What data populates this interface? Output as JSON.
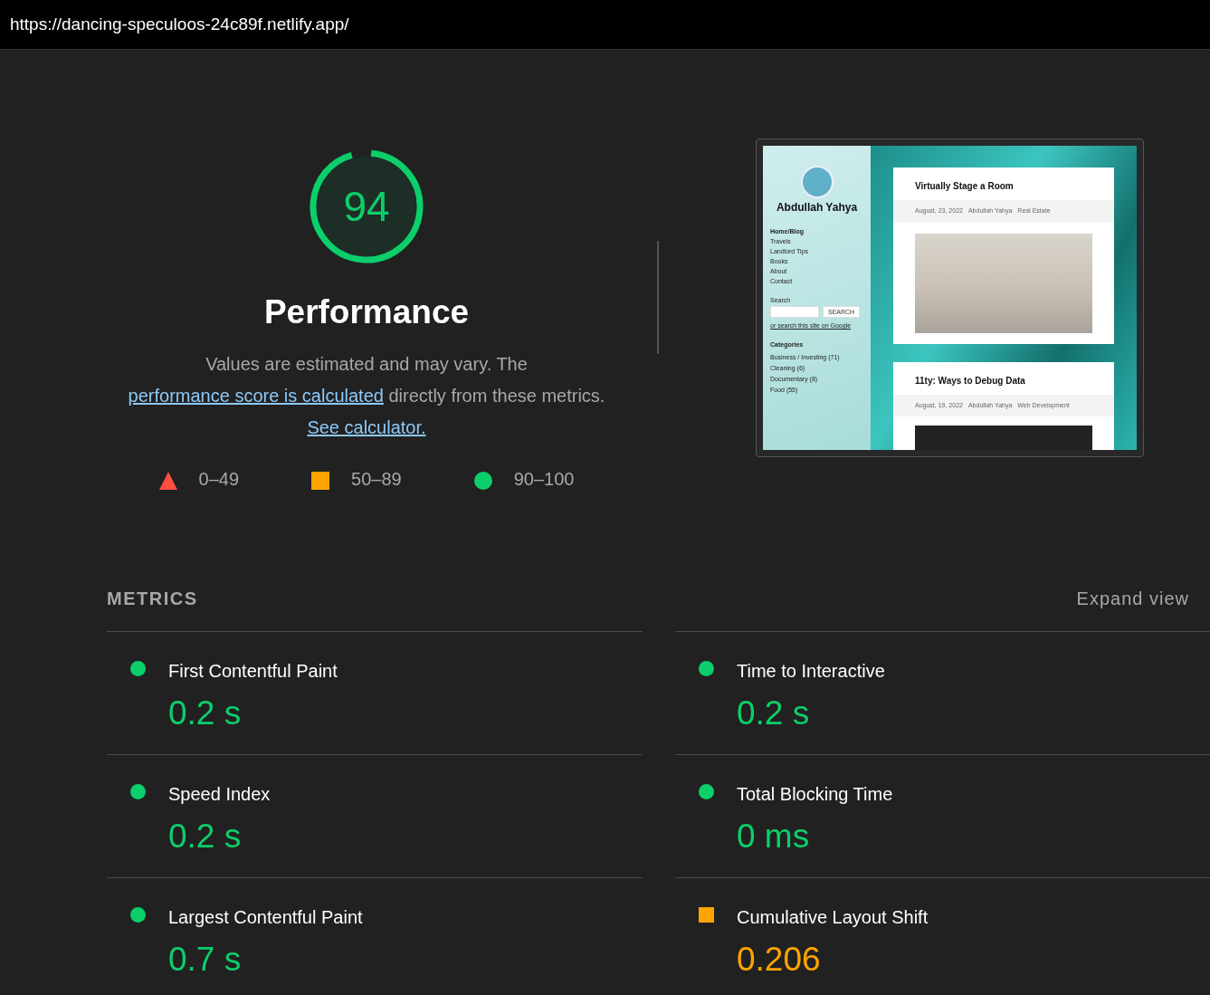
{
  "address_bar": {
    "url": "https://dancing-speculoos-24c89f.netlify.app/"
  },
  "gauge": {
    "score": "94",
    "level": 0.94,
    "kind": "pass",
    "title": "Performance"
  },
  "description": [
    {
      "kind": "text",
      "text": "Values are estimated and may vary. The"
    },
    {
      "kind": "link",
      "text": "performance score is calculated"
    },
    {
      "kind": "text",
      "text": "directly from these metrics."
    },
    {
      "kind": "link",
      "text": "See calculator."
    }
  ],
  "legend": [
    {
      "kind": "fail",
      "label": "0–49"
    },
    {
      "kind": "average",
      "label": "50–89"
    },
    {
      "kind": "pass",
      "label": "90–100"
    }
  ],
  "thumbnail": {
    "site_title": "Abdullah Yahya",
    "nav": [
      {
        "label": "Home/Blog",
        "selected": true
      },
      {
        "label": "Travels",
        "selected": false
      },
      {
        "label": "Landlord Tips",
        "selected": false
      },
      {
        "label": "Books",
        "selected": false
      },
      {
        "label": "About",
        "selected": false
      },
      {
        "label": "Contact",
        "selected": false
      }
    ],
    "search_label": "Search",
    "search_button": "SEARCH",
    "google_link": "or search this site on Google",
    "categories_title": "Categories",
    "categories": [
      "Business / Investing (71)",
      "Cleaning (6)",
      "Documentary (8)",
      "Food (55)"
    ],
    "posts": [
      {
        "title": "Virtually Stage a Room",
        "date": "August, 23, 2022",
        "author": "Abdullah Yahya",
        "category": "Real Estate",
        "kind": "photo"
      },
      {
        "title": "11ty: Ways to Debug Data",
        "date": "August, 19, 2022",
        "author": "Abdullah Yahya",
        "category": "Web Development",
        "kind": "code"
      }
    ]
  },
  "metrics": {
    "title": "METRICS",
    "expand": "Expand view",
    "items": [
      {
        "name": "First Contentful Paint",
        "value": "0.2 s",
        "kind": "pass"
      },
      {
        "name": "Time to Interactive",
        "value": "0.2 s",
        "kind": "pass"
      },
      {
        "name": "Speed Index",
        "value": "0.2 s",
        "kind": "pass"
      },
      {
        "name": "Total Blocking Time",
        "value": "0 ms",
        "kind": "pass"
      },
      {
        "name": "Largest Contentful Paint",
        "value": "0.7 s",
        "kind": "pass"
      },
      {
        "name": "Cumulative Layout Shift",
        "value": "0.206",
        "kind": "average"
      }
    ]
  }
}
